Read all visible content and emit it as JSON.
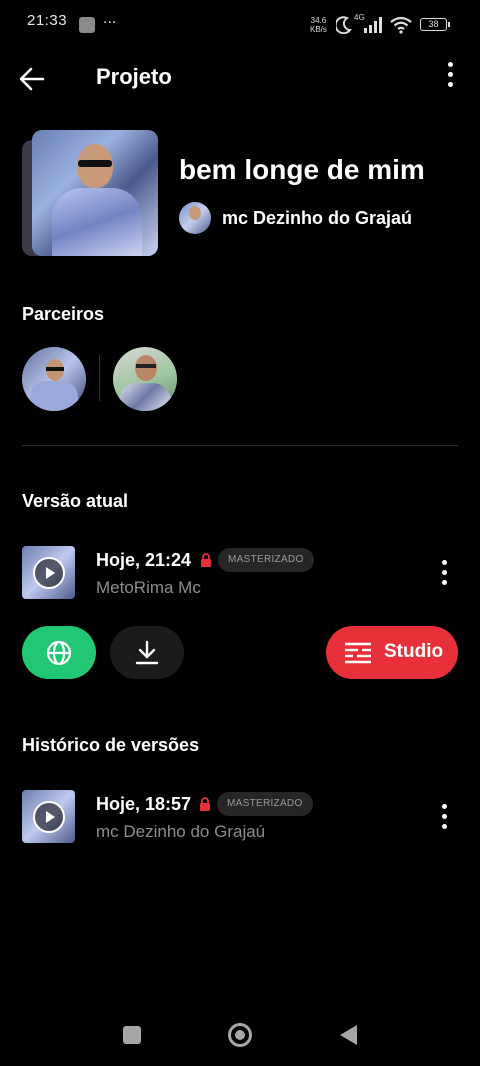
{
  "status_bar": {
    "time": "21:33",
    "more": "...",
    "speed_value": "34.6",
    "speed_unit": "KB/s",
    "network": "4G",
    "battery": "38"
  },
  "appbar": {
    "title": "Projeto"
  },
  "project": {
    "song_title": "bem longe de mim",
    "artist": "mc Dezinho do Grajaú"
  },
  "partners": {
    "label": "Parceiros"
  },
  "current_version": {
    "label": "Versão atual",
    "when": "Hoje, 21:24",
    "badge": "MASTERIZADO",
    "author": "MetoRima Mc"
  },
  "actions": {
    "studio_label": "Studio"
  },
  "history": {
    "label": "Histórico de versões",
    "items": [
      {
        "when": "Hoje, 18:57",
        "badge": "MASTERIZADO",
        "author": "mc Dezinho do Grajaú"
      }
    ]
  },
  "colors": {
    "accent_green": "#22c773",
    "accent_red": "#e8303a",
    "lock_red": "#e8303a",
    "background": "#000000"
  },
  "icons": [
    "back-arrow-icon",
    "more-vert-icon",
    "lock-icon",
    "globe-icon",
    "download-icon",
    "studio-equalizer-icon",
    "play-icon"
  ]
}
